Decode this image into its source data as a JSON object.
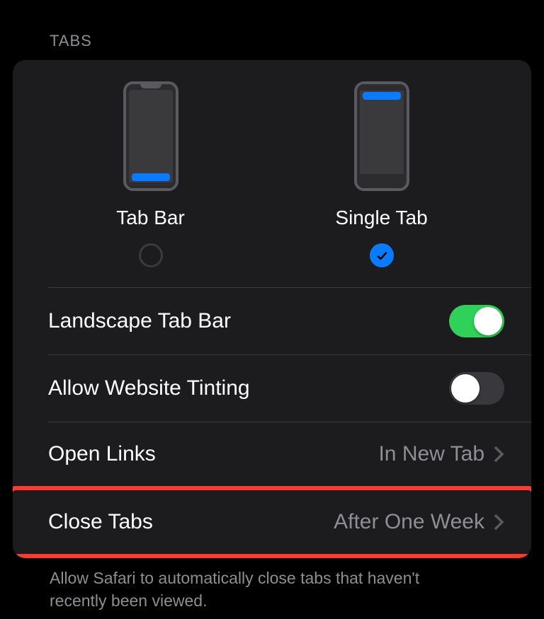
{
  "section_header": "TABS",
  "layout_options": {
    "option1": {
      "label": "Tab Bar",
      "selected": false
    },
    "option2": {
      "label": "Single Tab",
      "selected": true
    }
  },
  "rows": {
    "landscape": {
      "label": "Landscape Tab Bar",
      "enabled": true
    },
    "tinting": {
      "label": "Allow Website Tinting",
      "enabled": false
    },
    "open_links": {
      "label": "Open Links",
      "value": "In New Tab"
    },
    "close_tabs": {
      "label": "Close Tabs",
      "value": "After One Week"
    }
  },
  "footer": "Allow Safari to automatically close tabs that haven't recently been viewed."
}
